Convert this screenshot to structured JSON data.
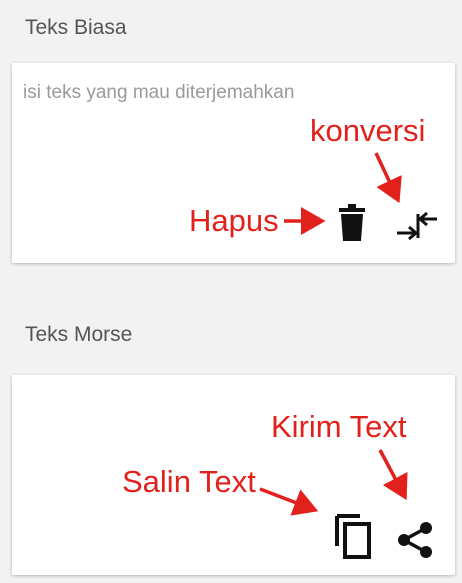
{
  "plain_text_section": {
    "label": "Teks Biasa",
    "input_placeholder": "isi teks yang mau diterjemahkan",
    "delete_icon": "trash-icon",
    "convert_icon": "convert-arrows-icon"
  },
  "morse_section": {
    "label": "Teks Morse",
    "copy_icon": "copy-icon",
    "share_icon": "share-icon"
  },
  "annotations": {
    "convert": "konversi",
    "delete": "Hapus",
    "share": "Kirim Text",
    "copy": "Salin Text",
    "color": "#e3211c"
  }
}
